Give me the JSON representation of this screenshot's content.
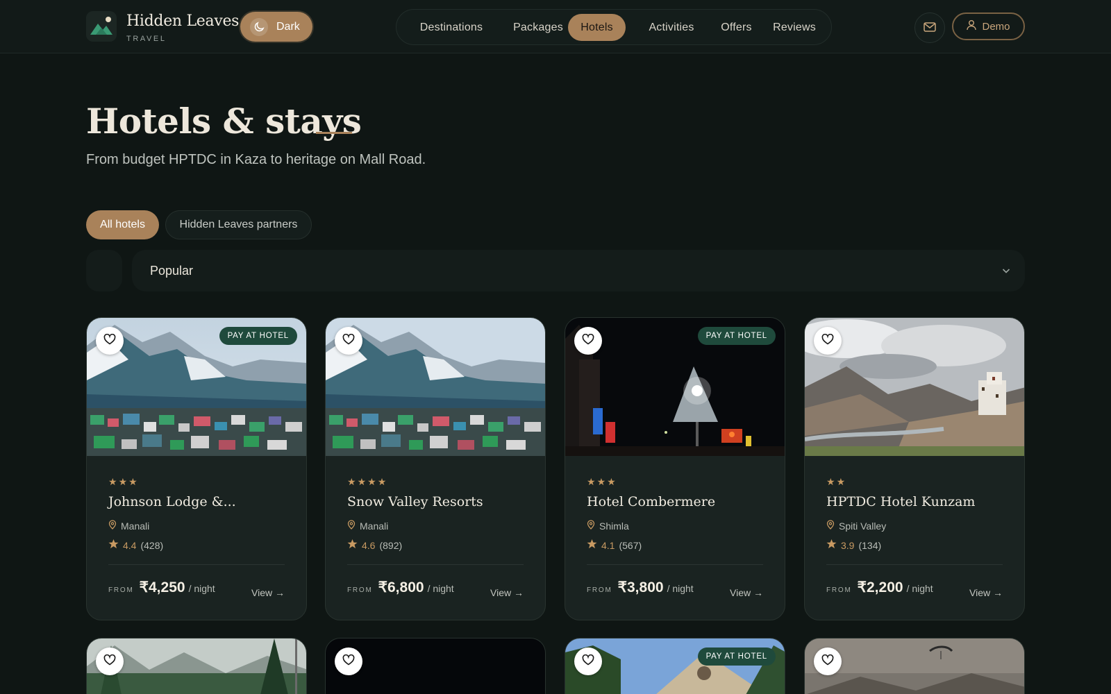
{
  "header": {
    "brand_name": "Hidden Leaves",
    "brand_sub": "TRAVEL",
    "theme_label": "Dark",
    "nav": [
      {
        "label": "Destinations",
        "active": false
      },
      {
        "label": "Packages",
        "active": false
      },
      {
        "label": "Hotels",
        "active": true
      },
      {
        "label": "Activities",
        "active": false
      },
      {
        "label": "Offers",
        "active": false
      },
      {
        "label": "Reviews",
        "active": false
      }
    ],
    "user_label": "Demo"
  },
  "page": {
    "title": "Hotels & stays",
    "subtitle": "From budget HPTDC in Kaza to heritage on Mall Road."
  },
  "filters": {
    "tabs": [
      {
        "label": "All hotels",
        "active": true
      },
      {
        "label": "Hidden Leaves partners",
        "active": false
      }
    ],
    "sort_value": "Popular"
  },
  "cards": [
    {
      "badge": "PAY AT HOTEL",
      "stars": 3,
      "name": "Johnson Lodge &...",
      "location": "Manali",
      "rating": "4.4",
      "reviews": "(428)",
      "from": "FROM",
      "price": "₹4,250",
      "per": "/ night",
      "view": "View →",
      "image": "mountain-valley-town"
    },
    {
      "badge": "",
      "stars": 4,
      "name": "Snow Valley Resorts",
      "location": "Manali",
      "rating": "4.6",
      "reviews": "(892)",
      "from": "FROM",
      "price": "₹6,800",
      "per": "/ night",
      "view": "View →",
      "image": "mountain-valley-town"
    },
    {
      "badge": "PAY AT HOTEL",
      "stars": 3,
      "name": "Hotel Combermere",
      "location": "Shimla",
      "rating": "4.1",
      "reviews": "(567)",
      "from": "FROM",
      "price": "₹3,800",
      "per": "/ night",
      "view": "View →",
      "image": "night-street"
    },
    {
      "badge": "",
      "stars": 2,
      "name": "HPTDC Hotel Kunzam",
      "location": "Spiti Valley",
      "rating": "3.9",
      "reviews": "(134)",
      "from": "FROM",
      "price": "₹2,200",
      "per": "/ night",
      "view": "View →",
      "image": "monastery-valley"
    },
    {
      "badge": "",
      "image": "pine-forest"
    },
    {
      "badge": "",
      "image": "dark-night"
    },
    {
      "badge": "PAY AT HOTEL",
      "image": "heritage-building"
    },
    {
      "badge": "",
      "image": "paragliding-haze"
    }
  ],
  "colors": {
    "accent": "#a9825a",
    "background": "#0f1614",
    "card": "#1a2321",
    "badge": "#1f4a3c",
    "star": "#c89a62"
  }
}
